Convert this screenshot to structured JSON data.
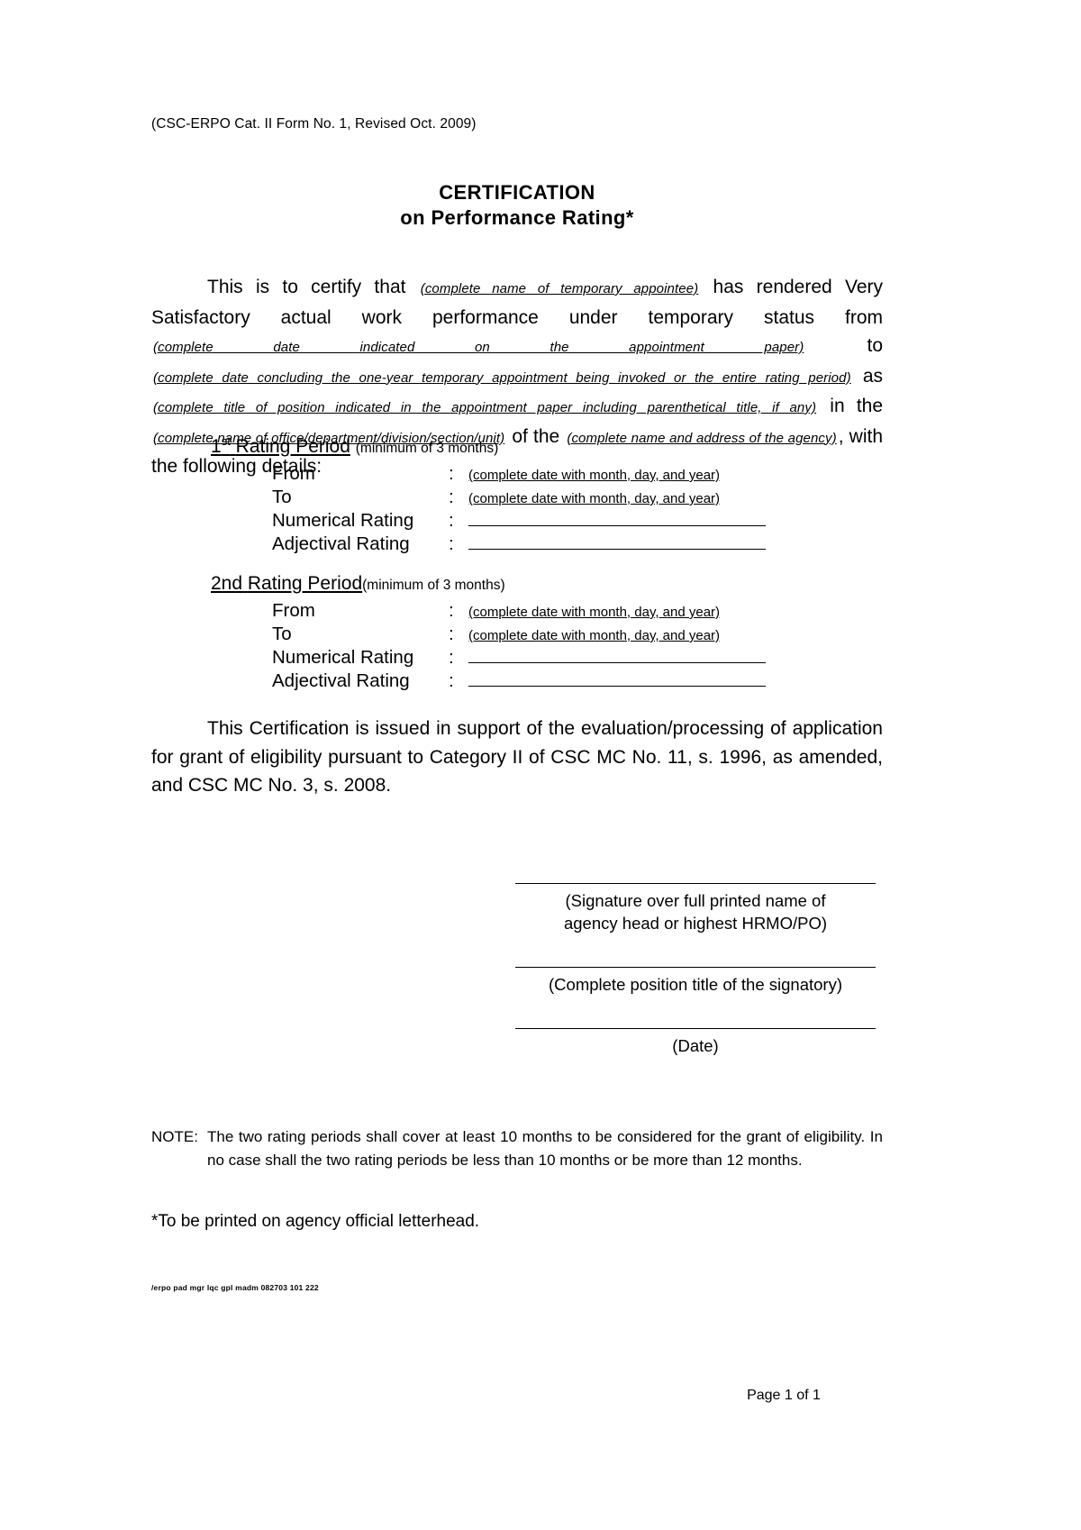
{
  "document": {
    "form_code": "(CSC-ERPO Cat. II Form No. 1, Revised Oct. 2009)",
    "title_line_1": "CERTIFICATION",
    "title_line_2": "on Performance Rating*",
    "page_number": "Page 1 of 1",
    "tiny_code": "/erpo pad mgr lqc gpl madm 082703 101 222",
    "footnote": "*To be printed on agency official letterhead."
  },
  "body": {
    "t1": "This is to certify that",
    "f1": "(complete name of temporary appointee)",
    "t2": "has rendered Very Satisfactory actual work performance under temporary status from",
    "f2": "(complete date indicated on the appointment paper)",
    "t3": "to",
    "f3": "(complete date concluding the one-year temporary appointment being invoked or the entire rating period)",
    "t4": "as",
    "f4": "(complete title of position indicated in the appointment paper including parenthetical title, if any)",
    "t5": "in the",
    "f5": "(complete name of office/department/division/section/unit)",
    "t6": "of the",
    "f6": "(complete name and address of the agency)",
    "t7": ", with the following details:"
  },
  "rating_periods": [
    {
      "name": "1st",
      "name_base": "1",
      "name_sup": "st",
      "label": "Rating Period",
      "minimum_note": "(minimum of 3 months)",
      "rows": [
        {
          "label": "From",
          "colon": ":",
          "value": "(complete date with month, day, and year)",
          "type": "text"
        },
        {
          "label": "To",
          "colon": ":",
          "value": "(complete date with month, day, and year)",
          "type": "text"
        },
        {
          "label": "Numerical Rating",
          "colon": ":",
          "value": "",
          "type": "blank"
        },
        {
          "label": "Adjectival Rating",
          "colon": ":",
          "value": "",
          "type": "blank"
        }
      ]
    },
    {
      "name": "2nd",
      "name_base": "2nd",
      "name_sup": "",
      "label": "Rating Period",
      "minimum_note": "(minimum of 3 months)",
      "rows": [
        {
          "label": "From",
          "colon": ":",
          "value": "(complete date with month, day, and year)",
          "type": "text"
        },
        {
          "label": "To",
          "colon": ":",
          "value": "(complete date with month, day, and year)",
          "type": "text"
        },
        {
          "label": "Numerical Rating",
          "colon": ":",
          "value": "",
          "type": "blank"
        },
        {
          "label": "Adjectival Rating",
          "colon": ":",
          "value": "",
          "type": "blank"
        }
      ]
    }
  ],
  "closing": {
    "text": "This Certification is issued in support of the evaluation/processing of application for grant of eligibility pursuant to Category II of CSC MC No. 11, s. 1996, as amended, and CSC MC No. 3, s. 2008."
  },
  "signature_block": [
    {
      "caption_line_1": "(Signature over full printed name of",
      "caption_line_2": "agency head or highest HRMO/PO)"
    },
    {
      "caption_line_1": "(Complete position title of the signatory)",
      "caption_line_2": ""
    },
    {
      "caption_line_1": "(Date)",
      "caption_line_2": ""
    }
  ],
  "note": {
    "label": "NOTE:",
    "text": "The two rating periods shall cover at least 10 months to be considered for the grant of eligibility. In no case shall the two rating periods be less than 10 months or be more than 12 months."
  }
}
